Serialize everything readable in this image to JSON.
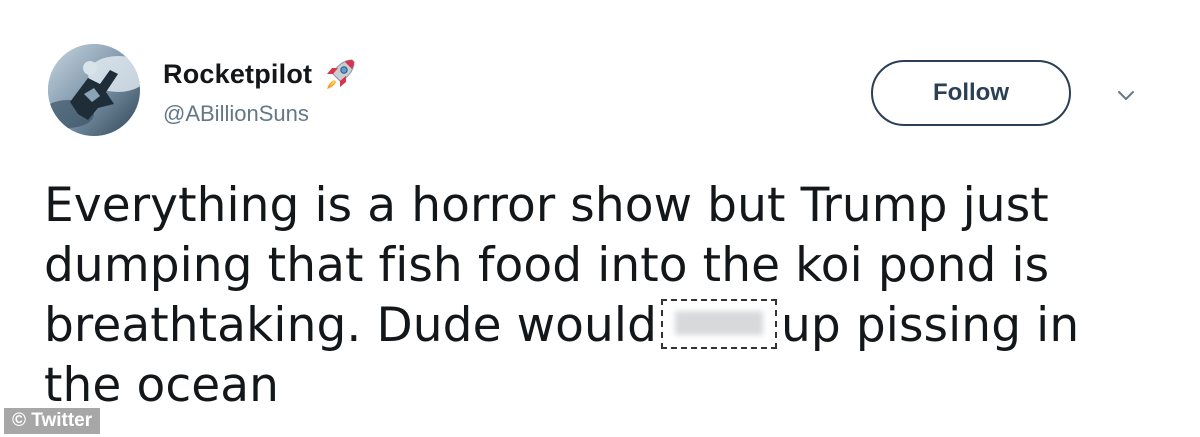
{
  "tweet": {
    "display_name": "Rocketpilot",
    "name_emoji": "rocket-icon",
    "handle": "@ABillionSuns",
    "follow_label": "Follow",
    "menu_icon": "chevron-down-icon",
    "text_part1": "Everything is a horror show but Trump just dumping that fish food into the koi pond is breathtaking. Dude would",
    "censored_word": "",
    "text_part2": "up pissing in the ocean"
  },
  "watermark": {
    "text": "© Twitter"
  },
  "colors": {
    "text": "#14171a",
    "handle": "#657786",
    "follow_border": "#2b3f55"
  }
}
